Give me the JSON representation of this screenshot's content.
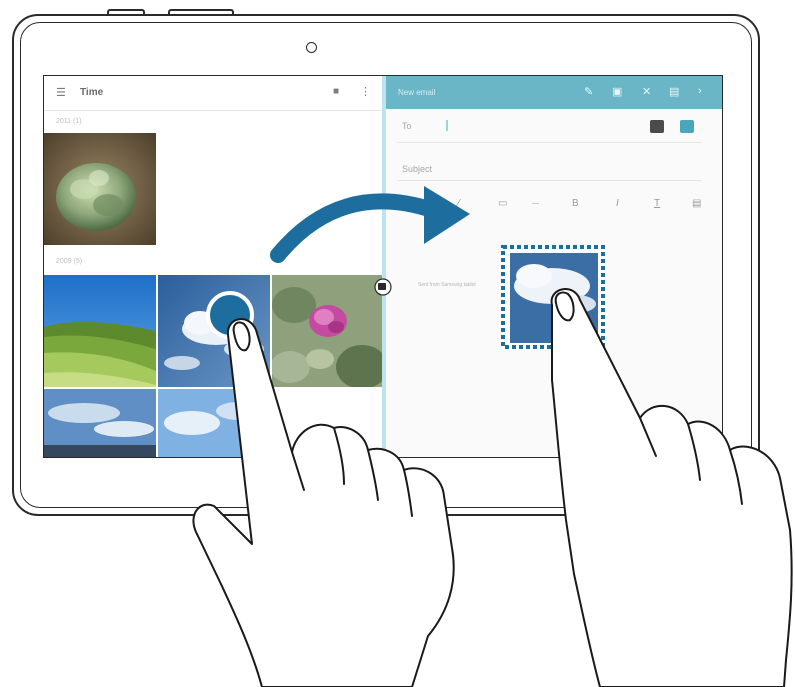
{
  "gallery": {
    "title": "Time",
    "menu_icon": "hamburger-icon",
    "camera_icon": "camera-icon",
    "more_icon": "more-icon",
    "sections": [
      "2011 (1)",
      "2009 (5)"
    ]
  },
  "email": {
    "title": "New email",
    "toolbar_icons": [
      "pen-icon",
      "attach-icon",
      "close-icon",
      "send-icon",
      "more-icon"
    ],
    "to_label": "To",
    "subject_label": "Subject",
    "signature": "Sent from Samsung tablet",
    "format_icons": [
      "image-icon",
      "text-color-icon",
      "bold-icon",
      "italic-icon",
      "underline-icon",
      "more-icon"
    ],
    "format_labels": [
      "B",
      "I",
      "T"
    ]
  },
  "colors": {
    "accent": "#1d6e9e",
    "email_toolbar": "#6ab6c6",
    "split_bar": "#bde4ee",
    "outline": "#2a2a2a"
  }
}
